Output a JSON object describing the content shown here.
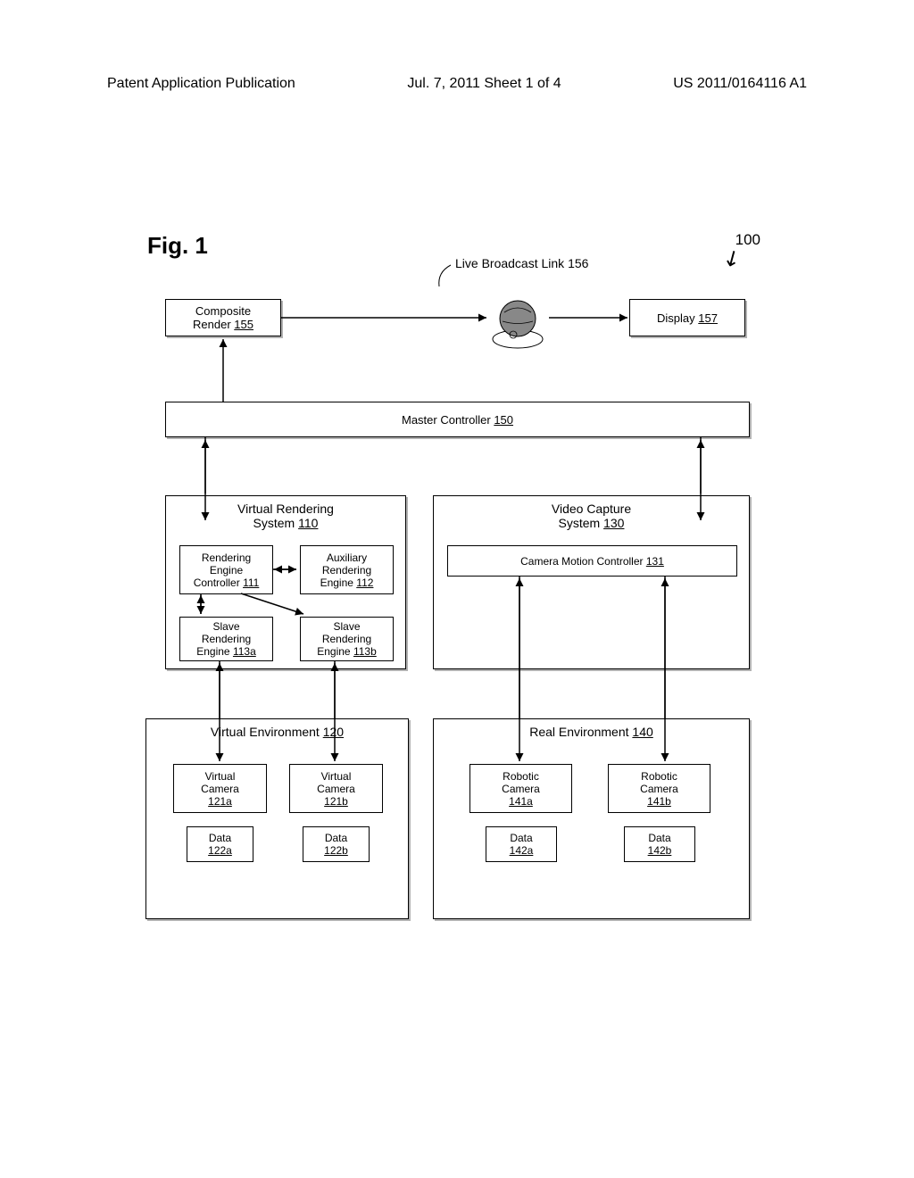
{
  "header": {
    "left": "Patent Application Publication",
    "center": "Jul. 7, 2011   Sheet 1 of 4",
    "right": "US 2011/0164116 A1"
  },
  "figure": {
    "label": "Fig. 1",
    "system_number": "100"
  },
  "labels": {
    "broadcast_link": "Live Broadcast Link 156",
    "composite_render": "Composite",
    "composite_render2": "Render",
    "composite_render_num": "155",
    "display": "Display",
    "display_num": "157",
    "master_controller": "Master Controller",
    "master_controller_num": "150",
    "virtual_rendering": "Virtual Rendering",
    "virtual_rendering2": "System",
    "virtual_rendering_num": "110",
    "video_capture": "Video Capture",
    "video_capture2": "System",
    "video_capture_num": "130",
    "rendering_engine": "Rendering",
    "rendering_engine2": "Engine",
    "rendering_engine3": "Controller",
    "rendering_engine_num": "111",
    "aux_rendering": "Auxiliary",
    "aux_rendering2": "Rendering",
    "aux_rendering3": "Engine",
    "aux_rendering_num": "112",
    "camera_motion": "Camera Motion Controller",
    "camera_motion_num": "131",
    "slave_a": "Slave",
    "slave_a2": "Rendering",
    "slave_a3": "Engine",
    "slave_a_num": "113a",
    "slave_b": "Slave",
    "slave_b2": "Rendering",
    "slave_b3": "Engine",
    "slave_b_num": "113b",
    "virtual_env": "Virtual Environment",
    "virtual_env_num": "120",
    "real_env": "Real Environment",
    "real_env_num": "140",
    "virtual_cam_a": "Virtual",
    "virtual_cam_a2": "Camera",
    "virtual_cam_a_num": "121a",
    "virtual_cam_b": "Virtual",
    "virtual_cam_b2": "Camera",
    "virtual_cam_b_num": "121b",
    "robotic_cam_a": "Robotic",
    "robotic_cam_a2": "Camera",
    "robotic_cam_a_num": "141a",
    "robotic_cam_b": "Robotic",
    "robotic_cam_b2": "Camera",
    "robotic_cam_b_num": "141b",
    "data_a": "Data",
    "data_a_num": "122a",
    "data_b": "Data",
    "data_b_num": "122b",
    "data_c": "Data",
    "data_c_num": "142a",
    "data_d": "Data",
    "data_d_num": "142b"
  }
}
